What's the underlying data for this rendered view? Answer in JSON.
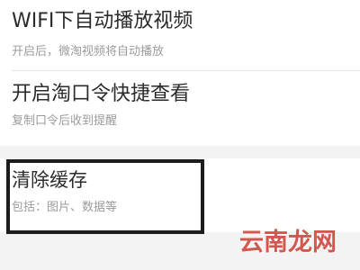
{
  "settings": {
    "wifi_autoplay": {
      "title": "WIFI下自动播放视频",
      "subtitle": "开启后，微淘视频将自动播放"
    },
    "taokouling": {
      "title": "开启淘口令快捷查看",
      "subtitle": "复制口令后收到提醒"
    },
    "clear_cache": {
      "title": "清除缓存",
      "subtitle": "包括：图片、数据等"
    }
  },
  "watermark": {
    "text": "云南龙网"
  },
  "colors": {
    "background": "#f3f3f3",
    "card": "#ffffff",
    "title_text": "#2b2b2b",
    "subtitle_text": "#9b9b9b",
    "highlight_frame": "#1c1c1c",
    "watermark": "#d3574e"
  }
}
